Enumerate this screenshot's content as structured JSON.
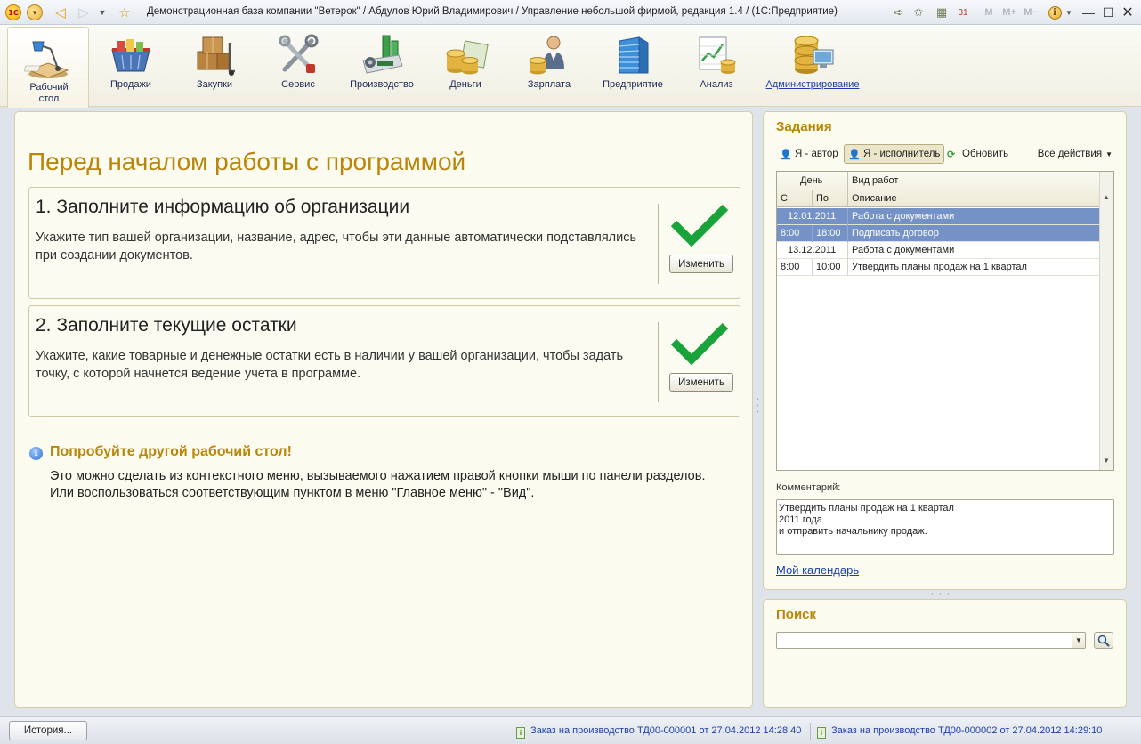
{
  "titlebar": {
    "logo": "1С",
    "title": "Демонстрационная база компании \"Ветерок\" / Абдулов Юрий Владимирович /  Управление небольшой фирмой, редакция 1.4 /  (1С:Предприятие)",
    "m_labels": [
      "M",
      "M+",
      "M−"
    ]
  },
  "sections": [
    {
      "label": "Рабочий стол",
      "icon": "desk-lamp-icon"
    },
    {
      "label": "Продажи",
      "icon": "shopping-basket-icon"
    },
    {
      "label": "Закупки",
      "icon": "boxes-cart-icon"
    },
    {
      "label": "Сервис",
      "icon": "tools-icon"
    },
    {
      "label": "Производство",
      "icon": "factory-icon"
    },
    {
      "label": "Деньги",
      "icon": "coins-icon"
    },
    {
      "label": "Зарплата",
      "icon": "worker-coins-icon"
    },
    {
      "label": "Предприятие",
      "icon": "building-icon"
    },
    {
      "label": "Анализ",
      "icon": "chart-icon"
    },
    {
      "label": "Администрирование",
      "icon": "database-monitor-icon"
    }
  ],
  "main": {
    "title": "Перед началом работы с программой",
    "cards": [
      {
        "title": "1. Заполните информацию об организации",
        "description": "Укажите тип вашей организации, название, адрес, чтобы эти данные автоматически подставлялись при создании документов.",
        "button": "Изменить"
      },
      {
        "title": "2. Заполните текущие остатки",
        "description": "Укажите, какие товарные и денежные остатки есть в наличии у вашей организации, чтобы задать точку, с которой начнется ведение учета в программе.",
        "button": "Изменить"
      }
    ],
    "info": {
      "title": "Попробуйте другой рабочий стол!",
      "line1": "Это можно сделать из контекстного меню, вызываемого нажатием правой кнопки мыши по панели разделов.",
      "line2": "Или воспользоваться соответствующим пунктом в меню \"Главное меню\" - \"Вид\"."
    }
  },
  "tasks": {
    "title": "Задания",
    "toolbar": {
      "author": "Я - автор",
      "executor": "Я - исполнитель",
      "refresh": "Обновить",
      "all_actions": "Все действия"
    },
    "columns": {
      "day": "День",
      "from": "С",
      "to": "По",
      "work_type": "Вид работ",
      "description": "Описание"
    },
    "rows": [
      {
        "type": "day",
        "text": "12.01.2011",
        "desc": "Работа с документами",
        "selected": true
      },
      {
        "type": "time",
        "from": "8:00",
        "to": "18:00",
        "desc": "Подписать договор",
        "selected": true
      },
      {
        "type": "day",
        "text": "13.12.2011",
        "desc": "Работа с документами",
        "selected": false
      },
      {
        "type": "time",
        "from": "8:00",
        "to": "10:00",
        "desc": "Утвердить планы продаж на 1 квартал",
        "selected": false
      }
    ],
    "comment_label": "Комментарий:",
    "comment_lines": [
      "Утвердить планы продаж на 1 квартал",
      "2011 года",
      "и отправить начальнику продаж."
    ],
    "calendar_link": "Мой календарь"
  },
  "search": {
    "title": "Поиск",
    "value": ""
  },
  "statusbar": {
    "history": "История...",
    "notifications": [
      "Заказ на производство ТД00-000001 от 27.04.2012 14:28:40",
      "Заказ на производство ТД00-000002 от 27.04.2012 14:29:10"
    ]
  },
  "colors": {
    "accent": "#b8860b",
    "selection": "#7592c6",
    "link": "#1c3fa8",
    "check": "#1aa33a"
  }
}
